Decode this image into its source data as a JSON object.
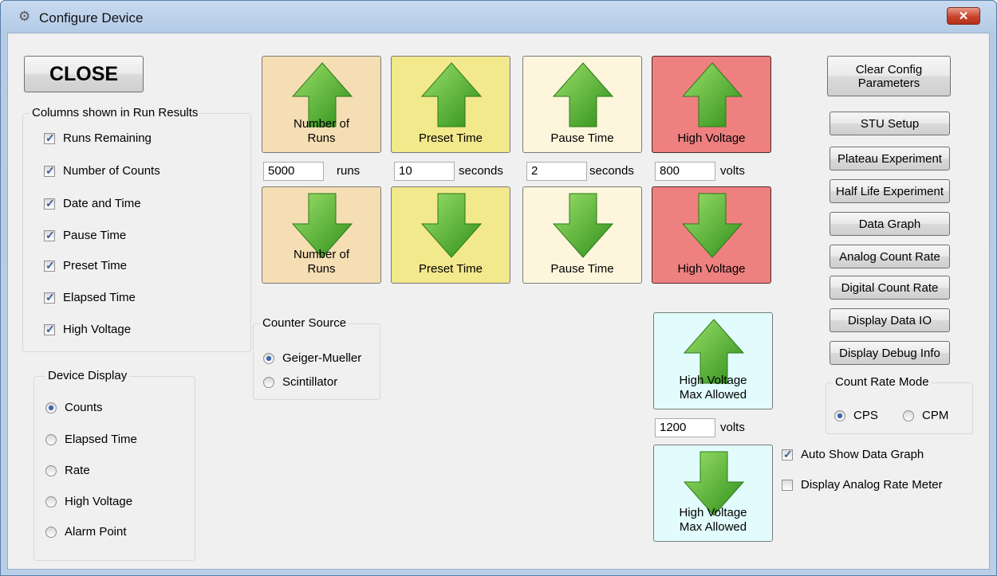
{
  "window": {
    "title": "Configure Device",
    "close_glyph": "✕"
  },
  "close_button": {
    "label": "CLOSE"
  },
  "columns_group": {
    "title": "Columns shown in Run Results",
    "items": [
      {
        "label": "Runs Remaining",
        "checked": true
      },
      {
        "label": "Number of Counts",
        "checked": true
      },
      {
        "label": "Date and Time",
        "checked": true
      },
      {
        "label": "Pause Time",
        "checked": true
      },
      {
        "label": "Preset Time",
        "checked": true
      },
      {
        "label": "Elapsed Time",
        "checked": true
      },
      {
        "label": "High Voltage",
        "checked": true
      }
    ]
  },
  "device_display": {
    "title": "Device Display",
    "options": [
      "Counts",
      "Elapsed Time",
      "Rate",
      "High Voltage",
      "Alarm Point"
    ],
    "selected": "Counts"
  },
  "counter_source": {
    "title": "Counter Source",
    "options": [
      "Geiger-Mueller",
      "Scintillator"
    ],
    "selected": "Geiger-Mueller"
  },
  "params": {
    "runs": {
      "label": "Number of Runs",
      "value": "5000",
      "unit": "runs",
      "color": "#f5deb3"
    },
    "preset": {
      "label": "Preset Time",
      "value": "10",
      "unit": "seconds",
      "color": "#f2e88c"
    },
    "pause": {
      "label": "Pause Time",
      "value": "2",
      "unit": "seconds",
      "color": "#fdf6dc"
    },
    "hv": {
      "label": "High Voltage",
      "value": "800",
      "unit": "volts",
      "color": "#ee8080"
    },
    "hvmax": {
      "label": "High Voltage Max Allowed",
      "value": "1200",
      "unit": "volts",
      "color": "#e2fcfd"
    }
  },
  "right_buttons": {
    "clear": "Clear Config Parameters",
    "stu": "STU Setup",
    "plateau": "Plateau Experiment",
    "halflife": "Half Life Experiment",
    "graph": "Data Graph",
    "analog": "Analog Count Rate",
    "digital": "Digital Count Rate",
    "dataio": "Display Data IO",
    "debug": "Display Debug Info"
  },
  "count_rate_mode": {
    "title": "Count Rate Mode",
    "options": [
      "CPS",
      "CPM"
    ],
    "selected": "CPS"
  },
  "options": {
    "auto_graph": {
      "label": "Auto Show Data Graph",
      "checked": true
    },
    "analog_meter": {
      "label": "Display Analog Rate Meter",
      "checked": false
    }
  },
  "icons": {
    "up": "arrow-up-icon",
    "down": "arrow-down-icon"
  }
}
